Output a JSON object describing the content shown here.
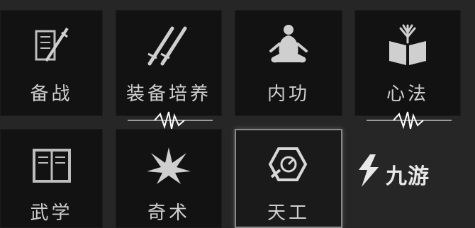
{
  "menu": {
    "tiles": [
      {
        "label": "备战",
        "icon": "book-sword-icon"
      },
      {
        "label": "装备培养",
        "icon": "swords-icon"
      },
      {
        "label": "内功",
        "icon": "meditation-icon"
      },
      {
        "label": "心法",
        "icon": "open-book-icon"
      },
      {
        "label": "武学",
        "icon": "scroll-book-icon"
      },
      {
        "label": "奇术",
        "icon": "burst-icon"
      },
      {
        "label": "天工",
        "icon": "gear-tool-icon",
        "selected": true
      }
    ]
  },
  "watermark": {
    "text": "九游",
    "icon": "jiuyou-logo-icon"
  },
  "colors": {
    "background": "#262626",
    "tile": "#121212",
    "text": "#cfcfcf",
    "selected_border": "#8a8a8a"
  }
}
